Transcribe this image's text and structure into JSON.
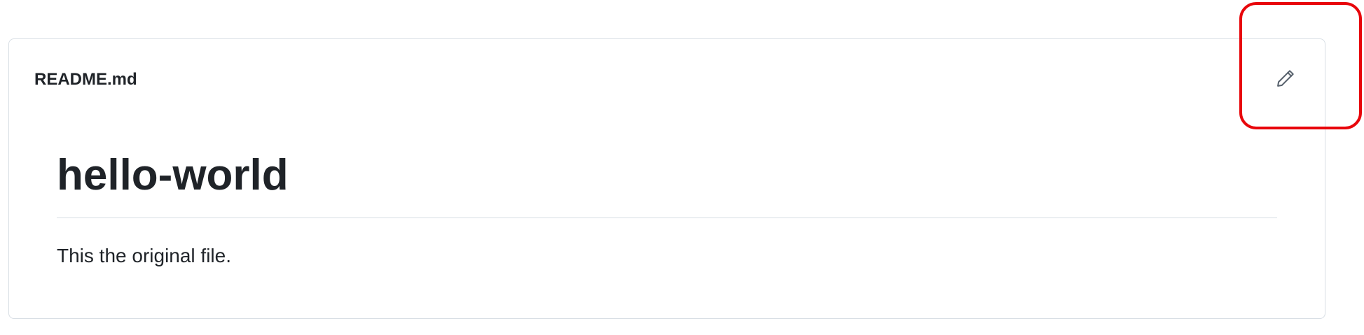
{
  "readme": {
    "file_name": "README.md",
    "edit_icon": "pencil-icon",
    "heading": "hello-world",
    "paragraph": "This the original file."
  },
  "annotation": {
    "highlight_color": "#e8060b",
    "target": "edit-file-button"
  },
  "colors": {
    "border": "#d8dee4",
    "text": "#1f2328",
    "icon": "#59636e"
  }
}
